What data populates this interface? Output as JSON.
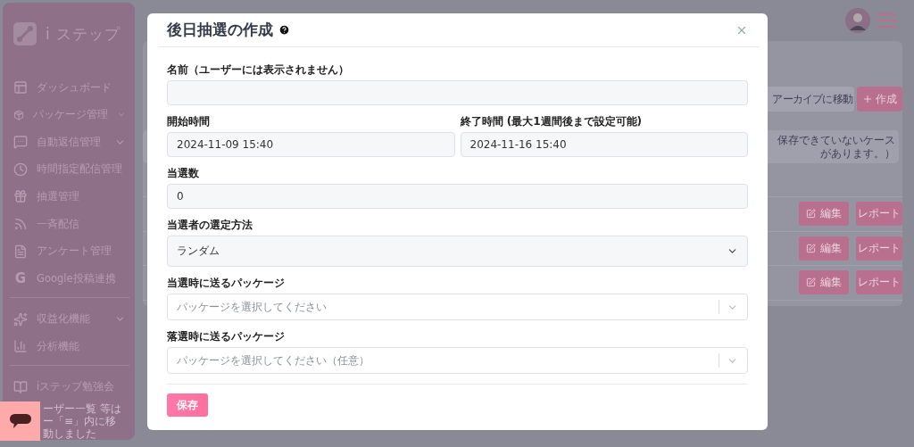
{
  "sidebar": {
    "brand": "i ステップ",
    "sections": [
      [
        {
          "label": "ダッシュボード",
          "expandable": false
        },
        {
          "label": "パッケージ管理",
          "expandable": true
        },
        {
          "label": "自動返信管理",
          "expandable": true
        },
        {
          "label": "時間指定配信管理",
          "expandable": false
        },
        {
          "label": "抽選管理",
          "expandable": false
        },
        {
          "label": "一斉配信",
          "expandable": false
        },
        {
          "label": "アンケート管理",
          "expandable": false
        },
        {
          "label": "Google投稿連携",
          "glyph": "G",
          "expandable": false
        }
      ],
      [
        {
          "label": "収益化機能",
          "expandable": true
        },
        {
          "label": "分析機能",
          "expandable": false
        }
      ],
      [
        {
          "label": "iステップ勉強会",
          "expandable": false
        }
      ]
    ],
    "notice_lines": [
      "ーザー一覧 等は",
      "ー「≡」内に移動しました"
    ]
  },
  "toolbar": {
    "buttons": [
      {
        "label": "アーカイブに移動",
        "kind": "archive"
      },
      {
        "label": "作成",
        "kind": "create"
      }
    ]
  },
  "notice": "保存できていないケースがあります。）",
  "rows": [
    {
      "actions": [
        "編集",
        "レポート"
      ]
    },
    {
      "actions": [
        "編集",
        "レポート"
      ]
    },
    {
      "actions": [
        "編集",
        "レポート"
      ]
    }
  ],
  "dialog": {
    "title": "後日抽選の作成",
    "rows": [
      [
        {
          "kind": "text",
          "label": "名前（ユーザーには表示されません）"
        }
      ],
      [
        {
          "kind": "text",
          "label": "開始時間",
          "value": "2024-11-09 15:40"
        },
        {
          "kind": "text",
          "label": "終了時間 (最大1週間後まで設定可能)",
          "value": "2024-11-16 15:40"
        }
      ],
      [
        {
          "kind": "text",
          "label": "当選数",
          "value": "0"
        }
      ],
      [
        {
          "kind": "select",
          "label": "当選者の選定方法",
          "value": "ランダム"
        }
      ],
      [
        {
          "kind": "combo",
          "label": "当選時に送るパッケージ",
          "placeholder": "パッケージを選択してください"
        }
      ],
      [
        {
          "kind": "combo",
          "label": "落選時に送るパッケージ",
          "placeholder": "パッケージを選択してください（任意）"
        }
      ]
    ],
    "save": "保存"
  }
}
